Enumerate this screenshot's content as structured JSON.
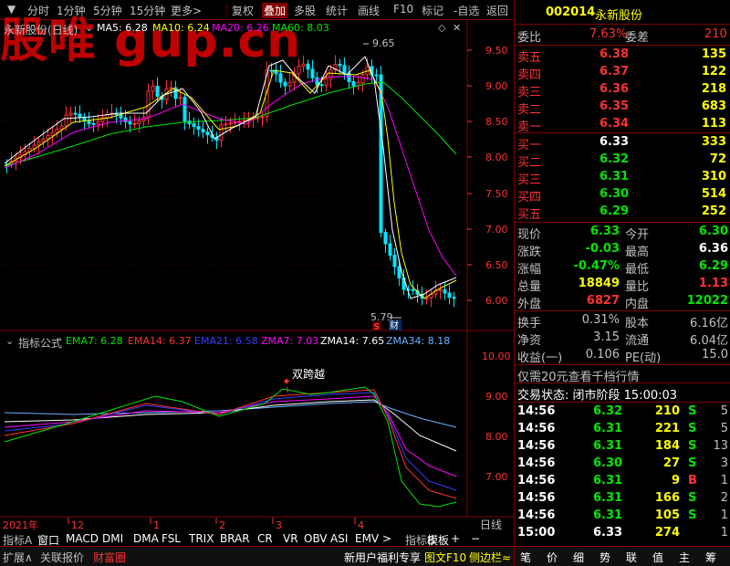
{
  "toolbar": [
    {
      "label": "分时"
    },
    {
      "label": "1分钟"
    },
    {
      "label": "5分钟"
    },
    {
      "label": "15分钟"
    },
    {
      "label": "更多>"
    },
    {
      "label": "复权"
    },
    {
      "label": "叠加"
    },
    {
      "label": "多股"
    },
    {
      "label": "统计"
    },
    {
      "label": "画线"
    },
    {
      "label": "F10"
    },
    {
      "label": "标记"
    },
    {
      "label": "-自选"
    },
    {
      "label": "返回"
    }
  ],
  "watermark": "股唯 gup.cn",
  "stock": {
    "code": "002014",
    "name": "永新股份"
  },
  "main_chart": {
    "title": "永新股份(日线)",
    "ma": [
      {
        "label": "MA5: 6.28",
        "color": "#ffffff"
      },
      {
        "label": "MA10: 6.24",
        "color": "#ffff00"
      },
      {
        "label": "MA20: 6.26",
        "color": "#ff00ff"
      },
      {
        "label": "MA60: 8.03",
        "color": "#00e600"
      }
    ],
    "yticks": [
      "9.50",
      "9.00",
      "8.50",
      "8.00",
      "7.50",
      "7.00",
      "6.50",
      "6.00"
    ],
    "high_label": "9.65",
    "low_label": "5.79",
    "marker_s": "S",
    "marker_cai": "财"
  },
  "indicator": {
    "title": "指标公式",
    "lines": [
      {
        "label": "EMA7: 6.28",
        "color": "#00e600"
      },
      {
        "label": "EMA14: 6.37",
        "color": "#ff3232"
      },
      {
        "label": "EMA21: 6.58",
        "color": "#3c3cff"
      },
      {
        "label": "ZMA7: 7.03",
        "color": "#ff00ff"
      },
      {
        "label": "ZMA14: 7.65",
        "color": "#ffffff"
      },
      {
        "label": "ZMA34: 8.18",
        "color": "#66b3ff"
      }
    ],
    "yticks": [
      "10.00",
      "9.00",
      "8.00",
      "7.00"
    ],
    "signal": "双跨越"
  },
  "xaxis": {
    "labels": [
      "2021年",
      "12",
      "1",
      "2",
      "3",
      "4"
    ],
    "period": "日线"
  },
  "tabs": [
    "指标A",
    "窗口",
    "MACD",
    "DMI",
    "DMA",
    "FSL",
    "TRIX",
    "BRAR",
    "CR",
    "VR",
    "OBV",
    "ASI",
    "EMV",
    ">",
    "指标B",
    "模板",
    "+",
    "−"
  ],
  "bottom_left": [
    "扩展∧",
    "关联报价",
    "财富圈"
  ],
  "bottom_right": [
    "新用户福利专享",
    "图文F10",
    "侧边栏≈"
  ],
  "bottom_icons": [
    "笔",
    "价",
    "细",
    "势",
    "联",
    "值",
    "主",
    "筹"
  ],
  "quote": {
    "weibi_label": "委比",
    "weibi": "7.63%",
    "weicha_label": "委差",
    "weicha": "210",
    "sell": [
      {
        "label": "卖五",
        "price": "6.38",
        "vol": "135"
      },
      {
        "label": "卖四",
        "price": "6.37",
        "vol": "122"
      },
      {
        "label": "卖三",
        "price": "6.36",
        "vol": "218"
      },
      {
        "label": "卖二",
        "price": "6.35",
        "vol": "683"
      },
      {
        "label": "卖一",
        "price": "6.34",
        "vol": "113"
      }
    ],
    "buy": [
      {
        "label": "买一",
        "price": "6.33",
        "vol": "333"
      },
      {
        "label": "买二",
        "price": "6.32",
        "vol": "72"
      },
      {
        "label": "买三",
        "price": "6.31",
        "vol": "310"
      },
      {
        "label": "买四",
        "price": "6.30",
        "vol": "514"
      },
      {
        "label": "买五",
        "price": "6.29",
        "vol": "252"
      }
    ],
    "stats": [
      {
        "l1": "现价",
        "v1": "6.33",
        "l2": "今开",
        "v2": "6.30"
      },
      {
        "l1": "涨跌",
        "v1": "-0.03",
        "l2": "最高",
        "v2": "6.36"
      },
      {
        "l1": "涨幅",
        "v1": "-0.47%",
        "l2": "最低",
        "v2": "6.29"
      },
      {
        "l1": "总量",
        "v1": "18849",
        "l2": "量比",
        "v2": "1.13"
      },
      {
        "l1": "外盘",
        "v1": "6827",
        "l2": "内盘",
        "v2": "12022"
      }
    ],
    "stats2": [
      {
        "l1": "换手",
        "v1": "0.31%",
        "l2": "股本",
        "v2": "6.16亿"
      },
      {
        "l1": "净资",
        "v1": "3.15",
        "l2": "流通",
        "v2": "6.04亿"
      },
      {
        "l1": "收益(一)",
        "v1": "0.106",
        "l2": "PE(动)",
        "v2": "15.0"
      }
    ],
    "promo": "仅需20元查看千档行情",
    "status": "交易状态: 闭市阶段 15:00:03"
  },
  "ticks": [
    {
      "time": "14:56",
      "price": "6.32",
      "vol": "210",
      "bs": "S",
      "n": "5"
    },
    {
      "time": "14:56",
      "price": "6.31",
      "vol": "221",
      "bs": "S",
      "n": "5"
    },
    {
      "time": "14:56",
      "price": "6.31",
      "vol": "184",
      "bs": "S",
      "n": "13"
    },
    {
      "time": "14:56",
      "price": "6.30",
      "vol": "27",
      "bs": "S",
      "n": "3"
    },
    {
      "time": "14:56",
      "price": "6.31",
      "vol": "9",
      "bs": "B",
      "n": "1"
    },
    {
      "time": "14:56",
      "price": "6.31",
      "vol": "166",
      "bs": "S",
      "n": "2"
    },
    {
      "time": "14:56",
      "price": "6.31",
      "vol": "105",
      "bs": "S",
      "n": "1"
    },
    {
      "time": "15:00",
      "price": "6.33",
      "vol": "274",
      "bs": "",
      "n": "1"
    }
  ]
}
